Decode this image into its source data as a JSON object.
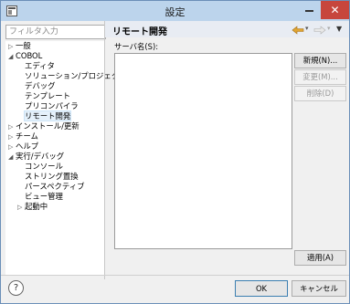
{
  "window": {
    "title": "設定"
  },
  "filter": {
    "placeholder": "フィルタ入力"
  },
  "tree": {
    "items": [
      {
        "label": "一般",
        "twisty": "▷",
        "indent": 0
      },
      {
        "label": "COBOL",
        "twisty": "◢",
        "indent": 0
      },
      {
        "label": "エディタ",
        "twisty": "",
        "indent": 1
      },
      {
        "label": "ソリューション/プロジェクト",
        "twisty": "",
        "indent": 1
      },
      {
        "label": "デバッグ",
        "twisty": "",
        "indent": 1
      },
      {
        "label": "テンプレート",
        "twisty": "",
        "indent": 1
      },
      {
        "label": "プリコンパイラ",
        "twisty": "",
        "indent": 1
      },
      {
        "label": "リモート開発",
        "twisty": "",
        "indent": 1,
        "selected": true
      },
      {
        "label": "インストール/更新",
        "twisty": "▷",
        "indent": 0
      },
      {
        "label": "チーム",
        "twisty": "▷",
        "indent": 0
      },
      {
        "label": "ヘルプ",
        "twisty": "▷",
        "indent": 0
      },
      {
        "label": "実行/デバッグ",
        "twisty": "◢",
        "indent": 0
      },
      {
        "label": "コンソール",
        "twisty": "",
        "indent": 1
      },
      {
        "label": "ストリング置換",
        "twisty": "",
        "indent": 1
      },
      {
        "label": "パースペクティブ",
        "twisty": "",
        "indent": 1
      },
      {
        "label": "ビュー管理",
        "twisty": "",
        "indent": 1
      },
      {
        "label": "起動中",
        "twisty": "▷",
        "indent": 1
      }
    ]
  },
  "page": {
    "title": "リモート開発",
    "server_label": "サーバ名(S):"
  },
  "buttons": {
    "new": "新規(N)...",
    "edit": "変更(M)...",
    "delete": "削除(D)",
    "apply": "適用(A)",
    "ok": "OK",
    "cancel": "キャンセル"
  },
  "icons": {
    "back": "back-arrow-icon",
    "forward": "forward-arrow-icon",
    "menu": "view-menu-icon",
    "help": "help-icon"
  },
  "colors": {
    "close_button": "#c7463c",
    "selection": "#e5f1fb"
  }
}
